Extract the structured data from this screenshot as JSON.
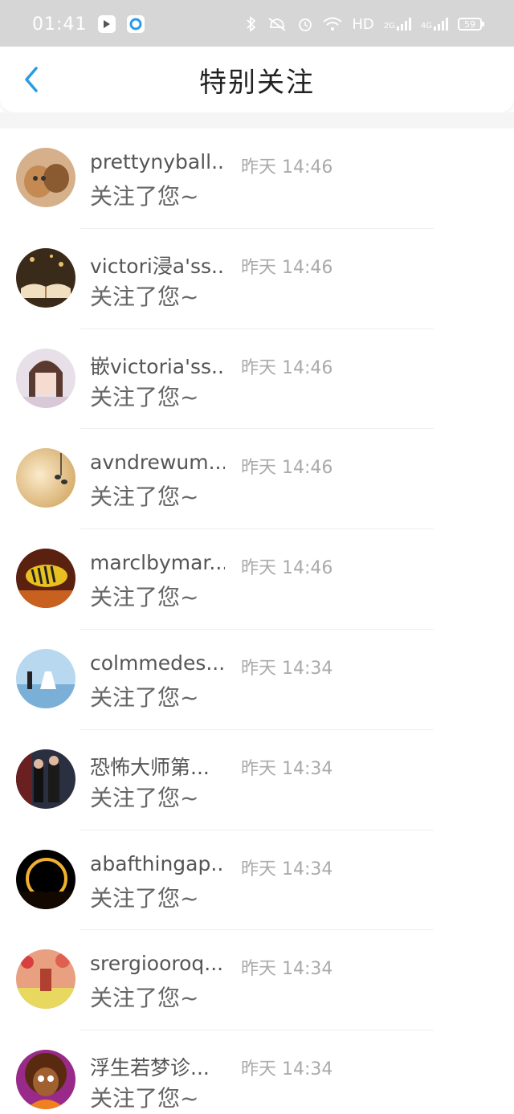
{
  "status_bar": {
    "time": "01:41",
    "hd_label": "HD",
    "net1": "2G",
    "net2": "4G",
    "battery": "59"
  },
  "nav": {
    "title": "特别关注",
    "back_icon": "chevron-left-icon"
  },
  "colors": {
    "accent": "#2b9be8",
    "status_bar_bg": "#d6d6d6"
  },
  "list": [
    {
      "name": "prettynyball...",
      "time": "昨天 14:46",
      "message": "关注了您~",
      "avatar": "kittens"
    },
    {
      "name": "victori浸a'ss...",
      "time": "昨天 14:46",
      "message": "关注了您~",
      "avatar": "open-book"
    },
    {
      "name": "嵌victoria'ss...",
      "time": "昨天 14:46",
      "message": "关注了您~",
      "avatar": "girl-portrait"
    },
    {
      "name": "avndrewum...",
      "time": "昨天 14:46",
      "message": "关注了您~",
      "avatar": "music-note"
    },
    {
      "name": "marclbymar...",
      "time": "昨天 14:46",
      "message": "关注了您~",
      "avatar": "fish"
    },
    {
      "name": "colmmedes...",
      "time": "昨天 14:34",
      "message": "关注了您~",
      "avatar": "beach-couple"
    },
    {
      "name": "恐怖大师第...",
      "time": "昨天 14:34",
      "message": "关注了您~",
      "avatar": "couple-night"
    },
    {
      "name": "abafthingap...",
      "time": "昨天 14:34",
      "message": "关注了您~",
      "avatar": "eclipse"
    },
    {
      "name": "srergiooroq...",
      "time": "昨天 14:34",
      "message": "关注了您~",
      "avatar": "flower-couple"
    },
    {
      "name": "浮生若梦诊...",
      "time": "昨天 14:34",
      "message": "关注了您~",
      "avatar": "cartoon-afro"
    }
  ]
}
